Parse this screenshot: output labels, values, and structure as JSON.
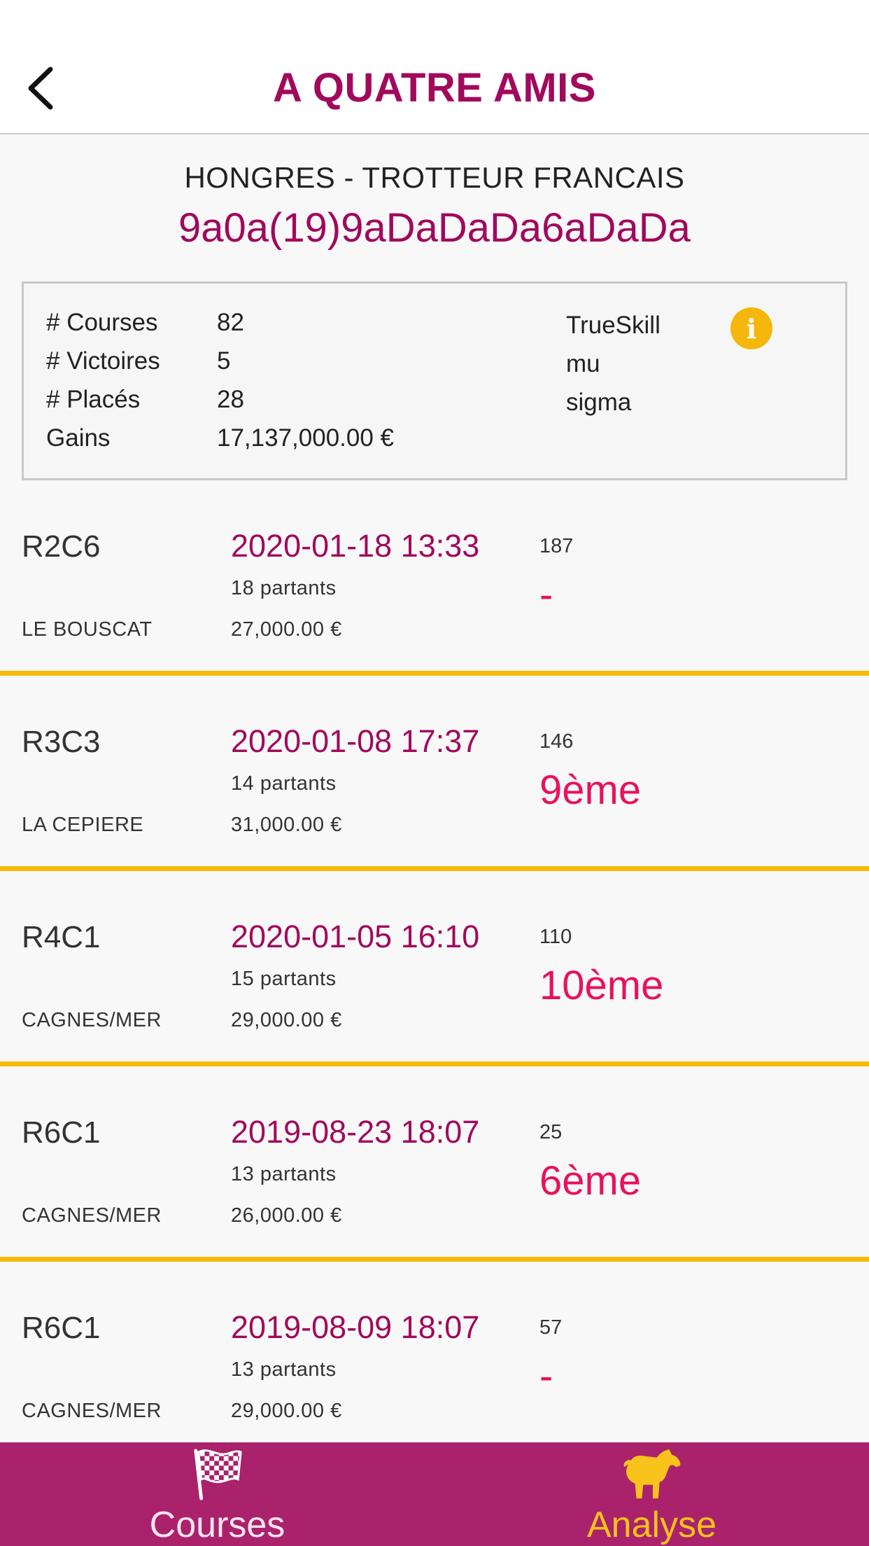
{
  "header": {
    "title": "A QUATRE AMIS",
    "back_icon": "chevron-left-icon"
  },
  "horse": {
    "category": "HONGRES - TROTTEUR FRANCAIS",
    "musique": "9a0a(19)9aDaDaDa6aDaDa"
  },
  "stats": {
    "courses_label": "# Courses",
    "courses_value": "82",
    "victoires_label": "# Victoires",
    "victoires_value": "5",
    "places_label": "# Placés",
    "places_value": "28",
    "gains_label": "Gains",
    "gains_value": "17,137,000.00 €",
    "trueskill_label": "TrueSkill",
    "mu_label": "mu",
    "sigma_label": "sigma",
    "info_icon": "info-icon",
    "info_color": "#f5b70c"
  },
  "races": [
    {
      "code": "R2C6",
      "venue": "LE BOUSCAT",
      "date": "2020-01-18 13:33",
      "partants": "18 partants",
      "prize": "27,000.00 €",
      "number": "187",
      "place": "-"
    },
    {
      "code": "R3C3",
      "venue": "LA CEPIERE",
      "date": "2020-01-08 17:37",
      "partants": "14 partants",
      "prize": "31,000.00 €",
      "number": "146",
      "place": "9ème"
    },
    {
      "code": "R4C1",
      "venue": "CAGNES/MER",
      "date": "2020-01-05 16:10",
      "partants": "15 partants",
      "prize": "29,000.00 €",
      "number": "110",
      "place": "10ème"
    },
    {
      "code": "R6C1",
      "venue": "CAGNES/MER",
      "date": "2019-08-23 18:07",
      "partants": "13 partants",
      "prize": "26,000.00 €",
      "number": "25",
      "place": "6ème"
    },
    {
      "code": "R6C1",
      "venue": "CAGNES/MER",
      "date": "2019-08-09 18:07",
      "partants": "13 partants",
      "prize": "29,000.00 €",
      "number": "57",
      "place": "-"
    }
  ],
  "nav": {
    "courses_label": "Courses",
    "courses_icon": "checkered-flag-icon",
    "analyse_label": "Analyse",
    "analyse_icon": "horse-icon"
  },
  "colors": {
    "brand": "#a1095c",
    "nav_bg": "#aa216c",
    "accent": "#f6bb09",
    "place": "#e8125c"
  }
}
